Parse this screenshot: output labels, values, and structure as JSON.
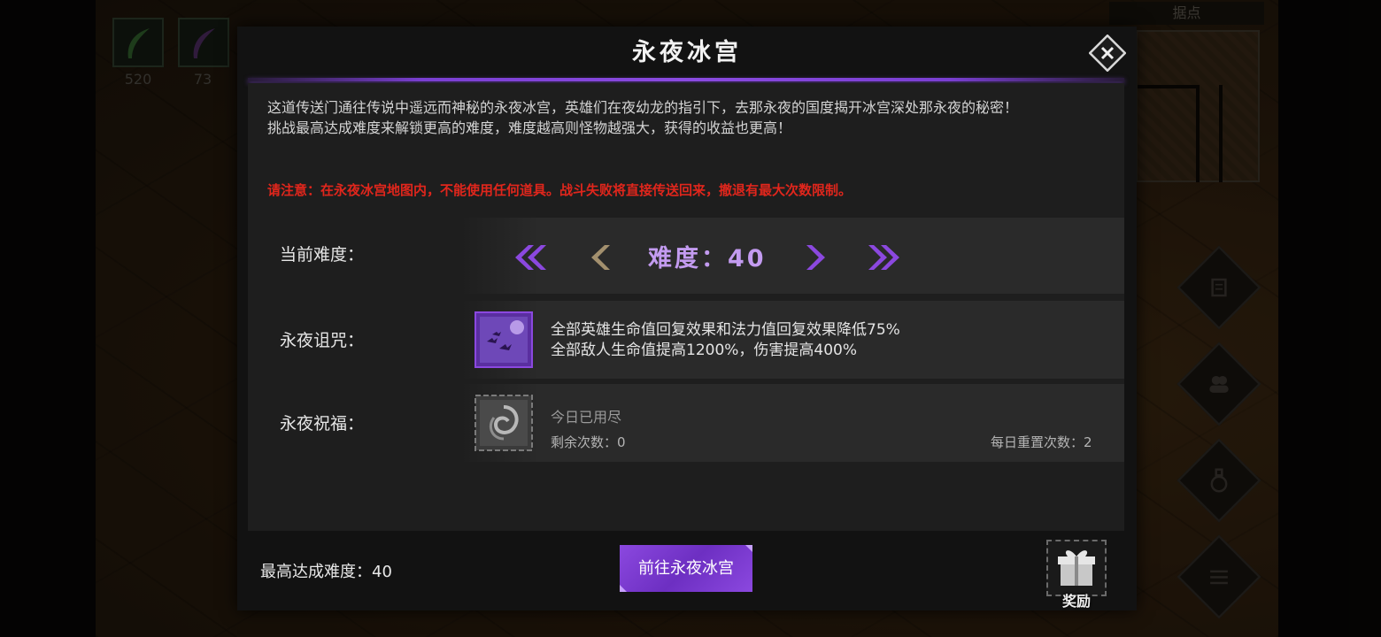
{
  "background": {
    "resources": [
      {
        "icon": "green-feather-icon",
        "count": "520"
      },
      {
        "icon": "purple-feather-icon",
        "count": "73"
      }
    ],
    "minimap_title": "据点",
    "side_buttons": [
      "quest-scroll-icon",
      "heroes-icon",
      "potion-icon",
      "menu-list-icon"
    ]
  },
  "modal": {
    "title": "永夜冰宫",
    "description_line1": "这道传送门通往传说中遥远而神秘的永夜冰宫，英雄们在夜幼龙的指引下，去那永夜的国度揭开冰宫深处那永夜的秘密！",
    "description_line2": "挑战最高达成难度来解锁更高的难度，难度越高则怪物越强大，获得的收益也更高！",
    "warning": "请注意：在永夜冰宫地图内，不能使用任何道具。战斗失败将直接传送回来，撤退有最大次数限制。",
    "difficulty": {
      "label": "当前难度：",
      "value_text": "难度：40"
    },
    "curse": {
      "label": "永夜诅咒：",
      "line1": "全部英雄生命值回复效果和法力值回复效果降低75%",
      "line2": "全部敌人生命值提高1200%，伤害提高400%"
    },
    "blessing": {
      "label": "永夜祝福：",
      "status": "今日已用尽",
      "remaining": "剩余次数：0",
      "daily_reset": "每日重置次数：2"
    },
    "footer": {
      "highest": "最高达成难度：40",
      "go_button": "前往永夜冰宫",
      "reward": "奖励"
    }
  },
  "colors": {
    "accent_purple": "#8b48df",
    "difficulty_text": "#c39bf0",
    "warning_red": "#e0261c"
  }
}
